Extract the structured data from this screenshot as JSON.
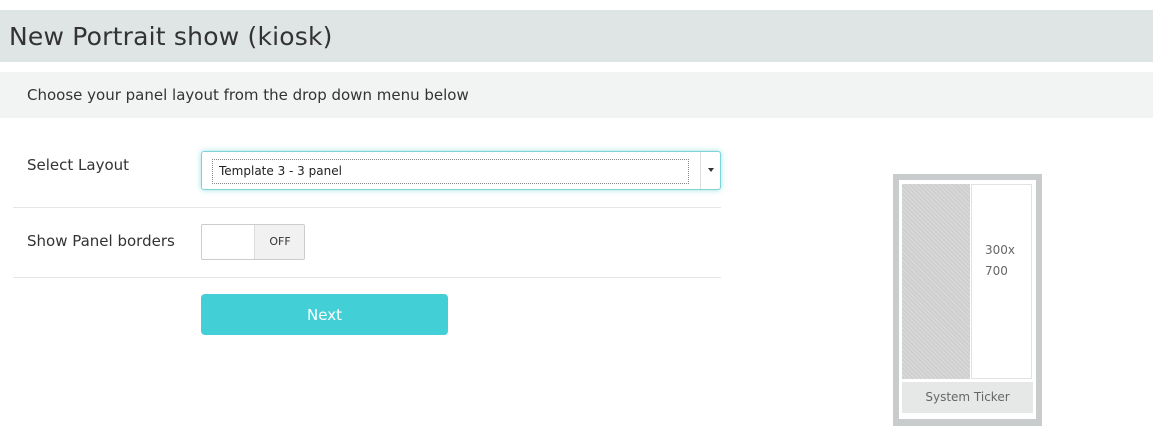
{
  "header": {
    "title": "New Portrait show (kiosk)",
    "subtitle": "Choose your panel layout from the drop down menu below"
  },
  "form": {
    "layout": {
      "label": "Select Layout",
      "selected": "Template 3 - 3 panel"
    },
    "borders": {
      "label": "Show Panel borders",
      "state": "OFF"
    },
    "next_label": "Next"
  },
  "preview": {
    "panel_size_line1": "300x",
    "panel_size_line2": "700",
    "ticker_label": "System Ticker"
  },
  "colors": {
    "accent": "#43cfd6",
    "header_bg": "#dfe4e4",
    "subheader_bg": "#f2f3f3"
  }
}
